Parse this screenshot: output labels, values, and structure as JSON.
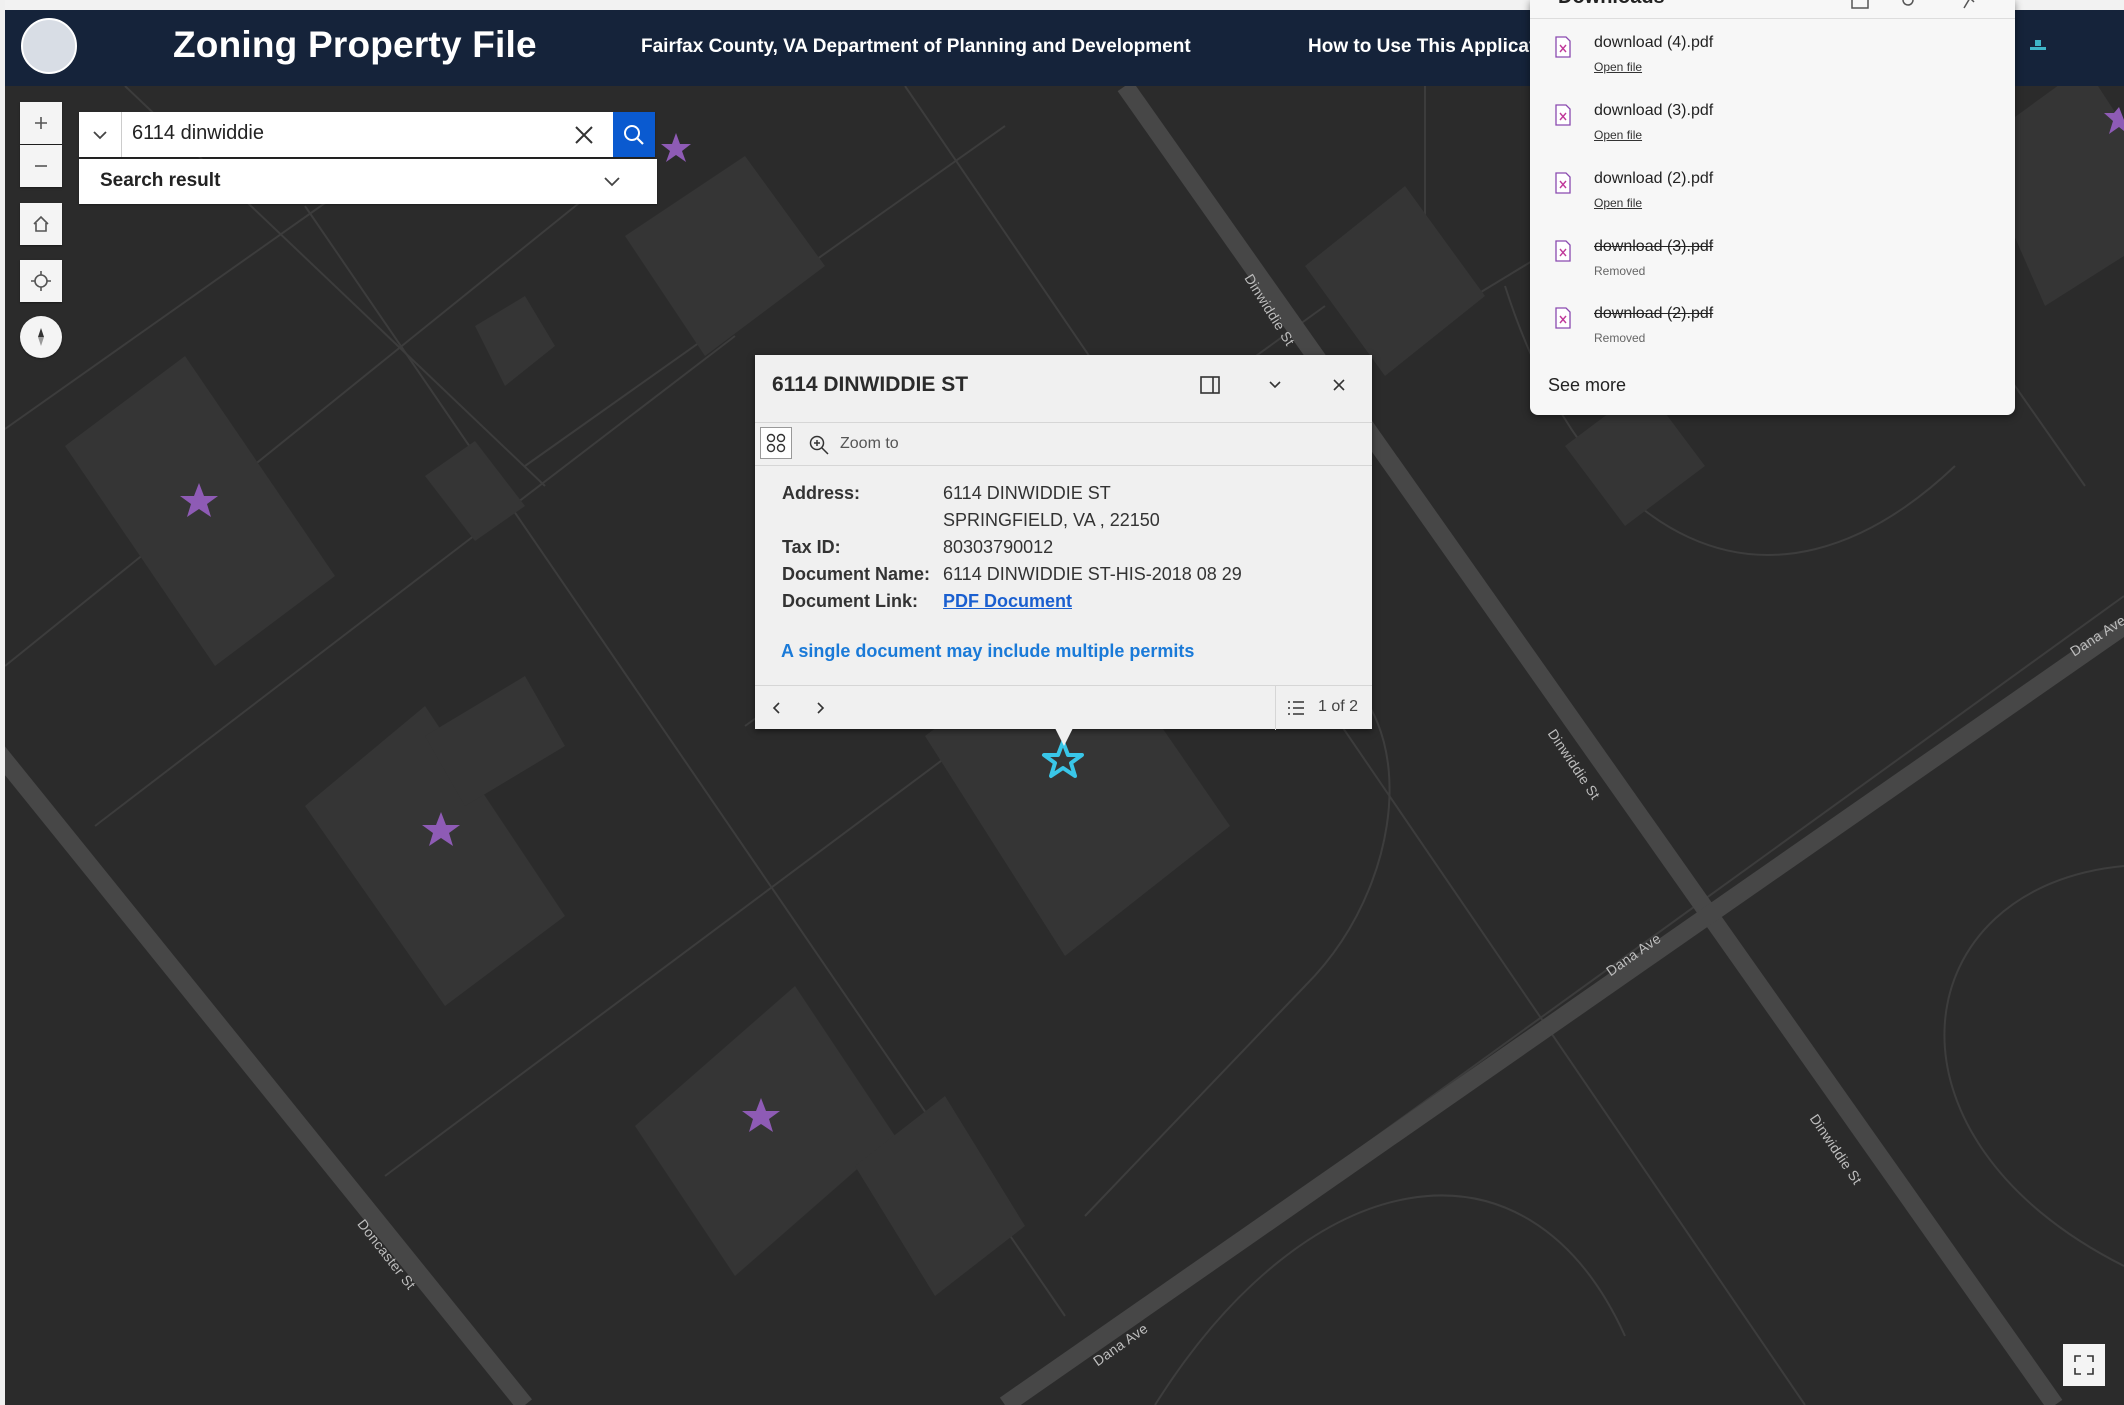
{
  "header": {
    "app_title": "Zoning Property File",
    "department": "Fairfax County, VA Department of Planning and Development",
    "how_to": "How to Use This Applicati"
  },
  "map_controls": [
    "zoom-in",
    "zoom-out",
    "home",
    "locate",
    "compass"
  ],
  "search": {
    "value": "6114 dinwiddie",
    "result_label": "Search result"
  },
  "street_labels": {
    "dinwiddie_1": "Dinwiddie St",
    "dinwiddie_2": "Dinwiddie St",
    "dinwiddie_3": "Dinwiddie St",
    "dana_1": "Dana Ave",
    "dana_2": "Dana Ave",
    "dana_3": "Dana Ave",
    "doncaster": "Doncaster St"
  },
  "popup": {
    "title": "6114 DINWIDDIE ST",
    "zoom_to": "Zoom to",
    "fields": {
      "address_label": "Address:",
      "address_line1": "6114 DINWIDDIE ST",
      "address_line2": "SPRINGFIELD,  VA , 22150",
      "tax_id_label": "Tax ID:",
      "tax_id": "80303790012",
      "doc_name_label": "Document Name:",
      "doc_name": "6114 DINWIDDIE ST-HIS-2018 08 29",
      "doc_link_label": "Document Link:",
      "doc_link": "PDF Document"
    },
    "note": "A single document may include multiple permits",
    "page_count": "1 of 2"
  },
  "downloads": {
    "title": "Downloads",
    "items": [
      {
        "name": "download (4).pdf",
        "sub": "Open file",
        "status": "open"
      },
      {
        "name": "download (3).pdf",
        "sub": "Open file",
        "status": "open"
      },
      {
        "name": "download (2).pdf",
        "sub": "Open file",
        "status": "open"
      },
      {
        "name": "download (3).pdf",
        "sub": "Removed",
        "status": "removed"
      },
      {
        "name": "download (2).pdf",
        "sub": "Removed",
        "status": "removed"
      }
    ],
    "see_more": "See more"
  },
  "colors": {
    "header_bg": "#15233a",
    "map_bg": "#2a2a2a",
    "search_button": "#0a5ad0",
    "link": "#1a5fd0",
    "note": "#1a7ad8",
    "marker_star": "#8e5bb5",
    "selected_star": "#39c6e8"
  }
}
